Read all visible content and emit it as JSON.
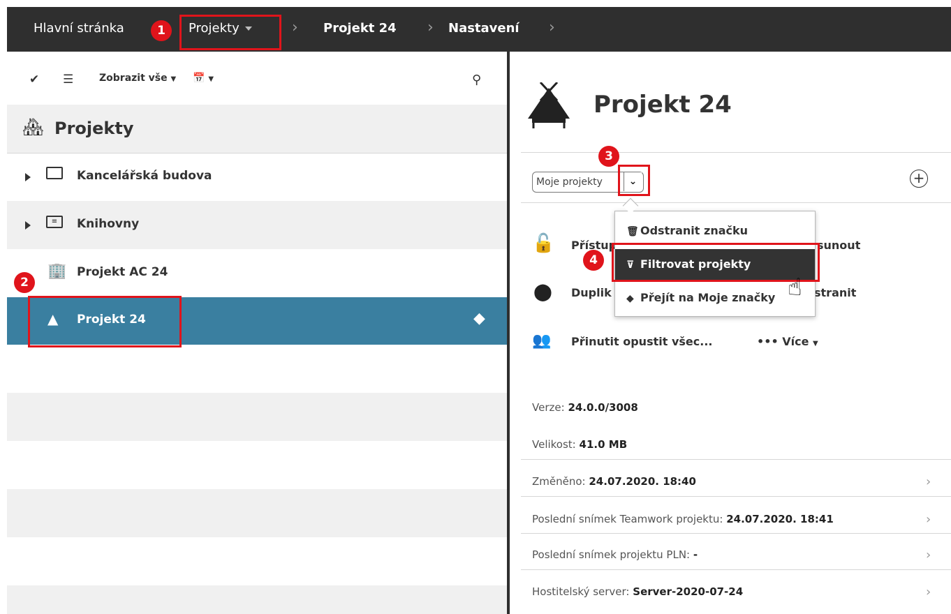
{
  "breadcrumb": {
    "home": "Hlavní stránka",
    "projects": "Projekty",
    "project": "Projekt 24",
    "settings": "Nastavení"
  },
  "annotations": [
    "1",
    "2",
    "3",
    "4"
  ],
  "left_panel": {
    "toolbar": {
      "show_all_label": "Zobrazit vše"
    },
    "title": "Projekty",
    "items": [
      {
        "label": "Kancelářská budova",
        "icon": "folder-icon"
      },
      {
        "label": "Knihovny",
        "icon": "library-folder-icon"
      },
      {
        "label": "Projekt AC 24",
        "icon": "building-icon"
      },
      {
        "label": "Projekt 24",
        "icon": "house-icon",
        "selected": true
      }
    ]
  },
  "right_panel": {
    "title": "Projekt 24",
    "filter_select": {
      "value": "Moje projekty"
    },
    "actions": {
      "access": "Přístup",
      "move": "sunout",
      "duplicate": "Duplik",
      "remove": "stranit",
      "force_leave": "Přinutit opustit všec...",
      "more": "Více"
    },
    "info": [
      {
        "label": "Verze:",
        "value": "24.0.0/3008",
        "chevron": false
      },
      {
        "label": "Velikost:",
        "value": "41.0 MB",
        "chevron": false
      },
      {
        "label": "Změněno:",
        "value": "24.07.2020. 18:40",
        "chevron": true
      },
      {
        "label": "Poslední snímek Teamwork projektu:",
        "value": "24.07.2020. 18:41",
        "chevron": true
      },
      {
        "label": "Poslední snímek projektu PLN:",
        "value": "-",
        "chevron": true
      },
      {
        "label": "Hostitelský server:",
        "value": "Server-2020-07-24",
        "chevron": true
      }
    ]
  },
  "dropdown_menu": {
    "items": [
      {
        "label": "Odstranit značku",
        "icon": "trash-icon"
      },
      {
        "label": "Filtrovat projekty",
        "icon": "filter-icon",
        "active": true
      },
      {
        "label": "Přejít na Moje značky",
        "icon": "tag-icon"
      }
    ]
  },
  "colors": {
    "topbar": "#2f2f2f",
    "selected_row": "#3a7fa0",
    "annotation": "#e0141b"
  }
}
